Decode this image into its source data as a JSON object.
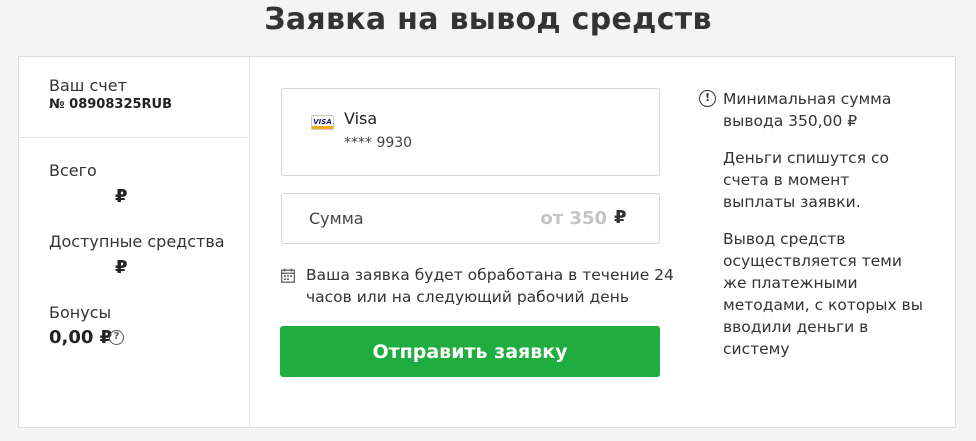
{
  "page": {
    "title": "Заявка на вывод средств"
  },
  "account": {
    "label": "Ваш счет",
    "number": "№ 08908325RUB"
  },
  "stats": {
    "total_label": "Всего",
    "total_value": "₽",
    "available_label": "Доступные средства",
    "available_value": "₽",
    "bonus_label": "Бонусы",
    "bonus_value": "0,00 ₽",
    "bonus_help": "?"
  },
  "payment_method": {
    "icon": "visa-card-icon",
    "icon_text": "VISA",
    "name": "Visa",
    "masked_number": "**** 9930"
  },
  "amount": {
    "label": "Сумма",
    "value": "",
    "placeholder": "от 350",
    "currency": "₽"
  },
  "processing_note": "Ваша заявка будет обработана в течение 24 часов или на следующий рабочий день",
  "submit_label": "Отправить заявку",
  "info": {
    "icon": "!",
    "min_amount": "Минимальная сумма вывода 350,00 ₽",
    "debit_note": "Деньги спишутся со счета в момент выплаты заявки.",
    "method_note": "Вывод средств осуществляется теми же платежными методами, с которых вы вводили деньги в систему"
  },
  "colors": {
    "accent": "#20ad3f",
    "placeholder": "#c4c4c4",
    "border": "#d7d7d7"
  }
}
